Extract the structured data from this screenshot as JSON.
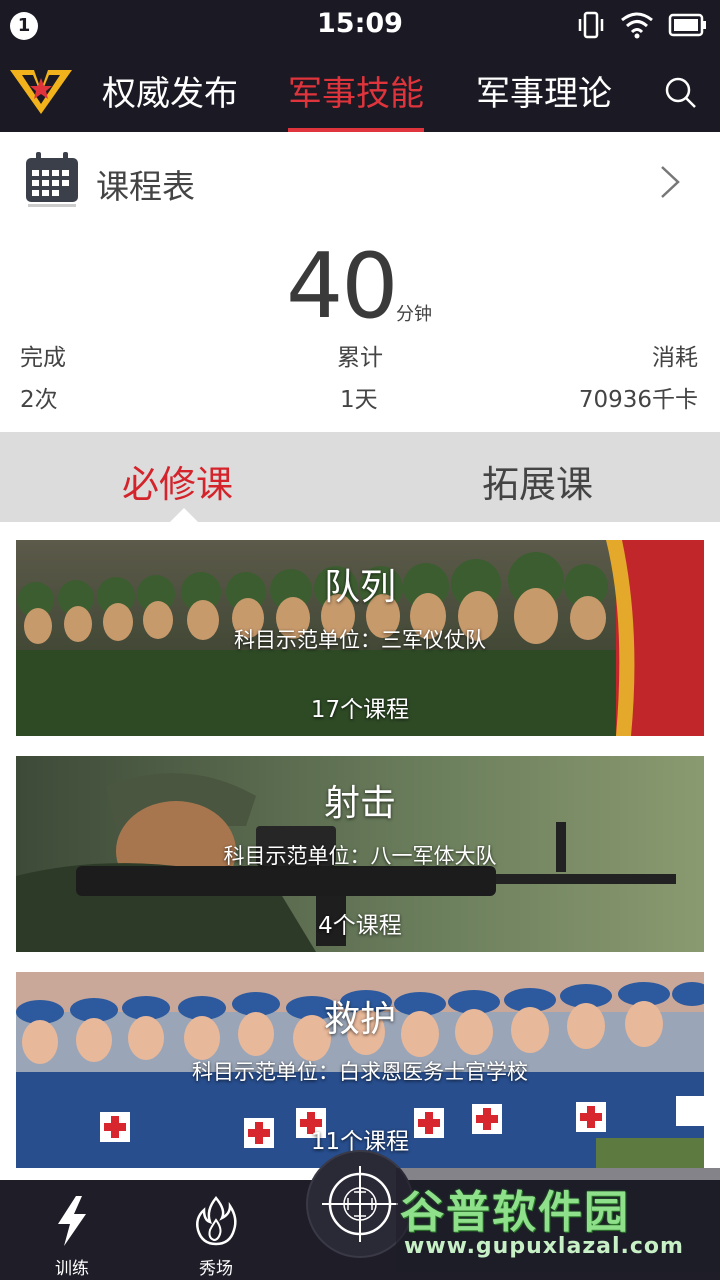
{
  "status_bar": {
    "notification_count": "1",
    "time": "15:09",
    "icons": [
      "vibrate-icon",
      "wifi-icon",
      "battery-icon"
    ]
  },
  "nav": {
    "logo_icon": "army-star-logo-icon",
    "tabs": [
      {
        "label": "权威发布",
        "active": false
      },
      {
        "label": "军事技能",
        "active": true
      },
      {
        "label": "军事理论",
        "active": false
      }
    ],
    "search_icon": "search-icon"
  },
  "schedule": {
    "title": "课程表",
    "icon": "calendar-icon"
  },
  "summary": {
    "minutes": "40",
    "minutes_unit": "分钟",
    "stats": [
      {
        "label": "完成",
        "value": "2次"
      },
      {
        "label": "累计",
        "value": "1天"
      },
      {
        "label": "消耗",
        "value": "70936千卡"
      }
    ]
  },
  "segment": {
    "options": [
      "必修课",
      "拓展课"
    ],
    "selected": "必修课"
  },
  "courses": [
    {
      "title": "队列",
      "subtitle": "科目示范单位：三军仪仗队",
      "count": "17个课程"
    },
    {
      "title": "射击",
      "subtitle": "科目示范单位：八一军体大队",
      "count": "4个课程"
    },
    {
      "title": "救护",
      "subtitle": "科目示范单位：白求恩医务士官学校",
      "count": "11个课程"
    }
  ],
  "bottom_nav": {
    "items": [
      {
        "label": "训练",
        "icon": "lightning-icon"
      },
      {
        "label": "秀场",
        "icon": "flame-icon"
      },
      {
        "label": "",
        "icon": "crosshair-icon"
      }
    ]
  },
  "watermark": {
    "brand": "谷普软件园",
    "url": "www.gupuxlazal.com"
  },
  "colors": {
    "header_bg": "#1b1a24",
    "accent": "#e0343c",
    "segment_bg": "#dcdcdc"
  }
}
